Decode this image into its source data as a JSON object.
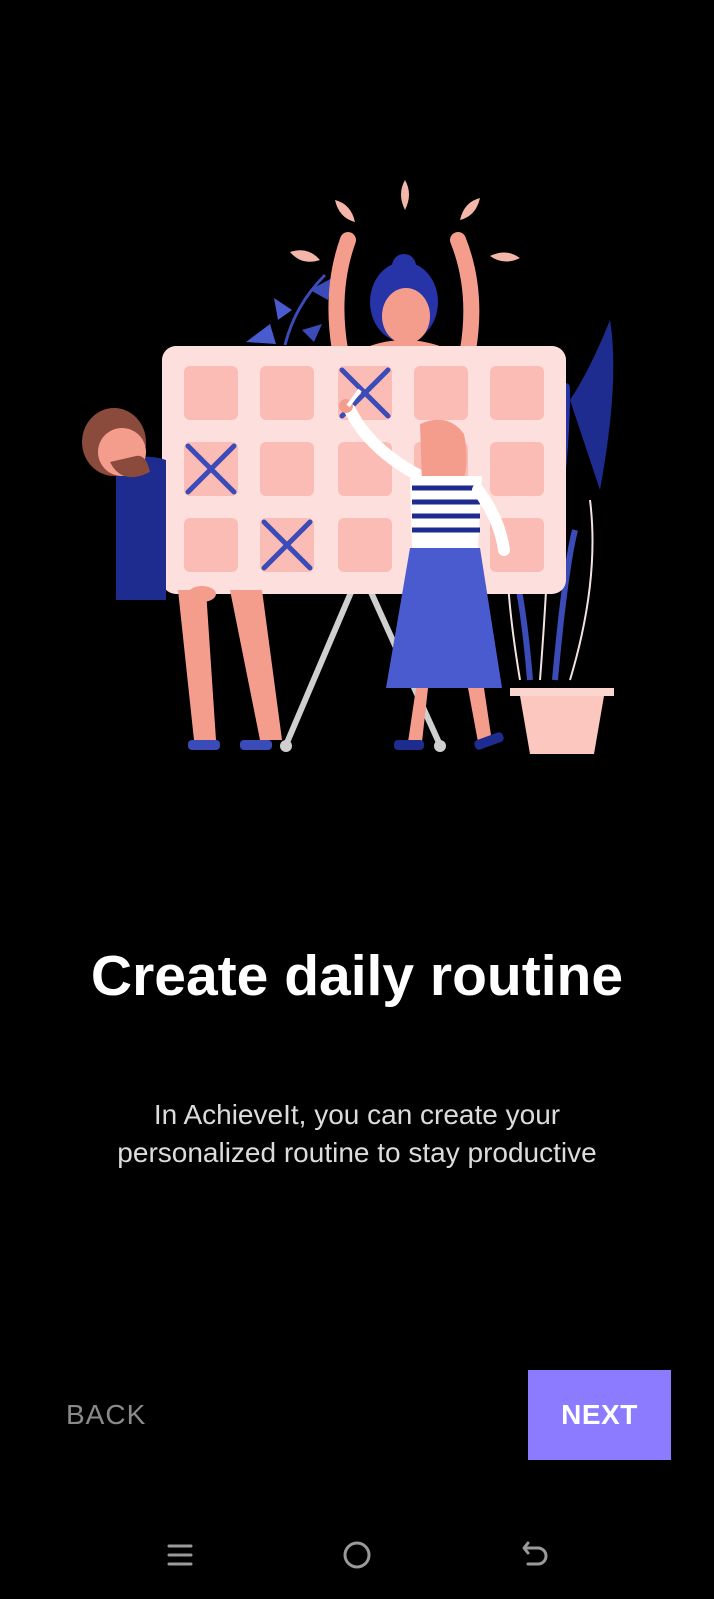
{
  "onboarding": {
    "title": "Create daily routine",
    "description_line1": "In AchieveIt, you can create your",
    "description_line2": "personalized routine to stay productive",
    "illustration": "people-marking-calendar-illustration"
  },
  "actions": {
    "back_label": "BACK",
    "next_label": "NEXT"
  },
  "system_nav": {
    "items": [
      "menu-icon",
      "home-icon",
      "back-icon"
    ]
  },
  "colors": {
    "background": "#000000",
    "accent": "#8c7bff",
    "back_text": "#8a8a8a",
    "body_text": "#dcdcdc",
    "calendar_panel": "#fde0dd",
    "calendar_cell": "#fbbcb5",
    "illustration_blue": "#3b4bb8",
    "illustration_navy": "#1f2c8f",
    "skin": "#f59d8d"
  }
}
